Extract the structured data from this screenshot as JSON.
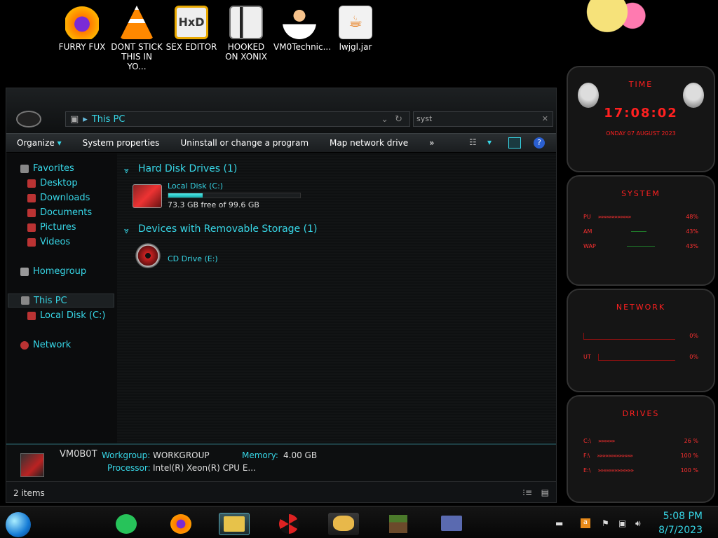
{
  "desktop_icons": [
    {
      "label": "FURRY FUX",
      "icon": "firefox-icon"
    },
    {
      "label": "DONT STICK THIS IN YO...",
      "icon": "vlc-icon"
    },
    {
      "label": "SEX EDITOR",
      "icon": "hxd-icon"
    },
    {
      "label": "HOOKED ON XONIX",
      "icon": "game-icon"
    },
    {
      "label": "VM0Technic...",
      "icon": "user-icon"
    },
    {
      "label": "lwjgl.jar",
      "icon": "java-icon"
    }
  ],
  "explorer": {
    "address": "This PC",
    "search_value": "syst",
    "toolbar": {
      "organize": "Organize",
      "system_properties": "System properties",
      "uninstall": "Uninstall or change a program",
      "map_drive": "Map network drive",
      "more": "»"
    },
    "nav": {
      "favorites": "Favorites",
      "desktop": "Desktop",
      "downloads": "Downloads",
      "documents": "Documents",
      "pictures": "Pictures",
      "videos": "Videos",
      "homegroup": "Homegroup",
      "this_pc": "This PC",
      "local_disk": "Local Disk (C:)",
      "network": "Network"
    },
    "groups": {
      "hdd_title": "Hard Disk Drives (1)",
      "removable_title": "Devices with Removable Storage (1)"
    },
    "drives": {
      "c_name": "Local Disk (C:)",
      "c_free": "73.3 GB free of 99.6 GB",
      "c_used_fraction": 0.26,
      "cd_name": "CD Drive (E:)"
    },
    "details": {
      "computer_name": "VM0B0T",
      "workgroup_label": "Workgroup:",
      "workgroup_value": "WORKGROUP",
      "memory_label": "Memory:",
      "memory_value": "4.00 GB",
      "processor_label": "Processor:",
      "processor_value": "Intel(R) Xeon(R) CPU E..."
    },
    "status": "2 items"
  },
  "gadgets": {
    "time_title": "TIME",
    "clock": "17:08:02",
    "date": "ONDAY 07 AUGUST 2023",
    "system_title": "SYSTEM",
    "cpu_label": "PU",
    "cpu_value": "48%",
    "ram_label": "AM",
    "ram_value": "43%",
    "swap_label": "WAP",
    "swap_value": "43%",
    "network_title": "NETWORK",
    "net_in_value": "0%",
    "net_out_label": "UT",
    "net_out_value": "0%",
    "drives_title": "DRIVES",
    "drive_c_label": "C:\\",
    "drive_c_value": "26 %",
    "drive_f_label": "F:\\",
    "drive_f_value": "100 %",
    "drive_e_label": "E:\\",
    "drive_e_value": "100 %"
  },
  "taskbar": {
    "time": "5:08 PM",
    "date": "8/7/2023"
  },
  "colors": {
    "accent": "#37d6e6",
    "alert": "#ff2020"
  }
}
